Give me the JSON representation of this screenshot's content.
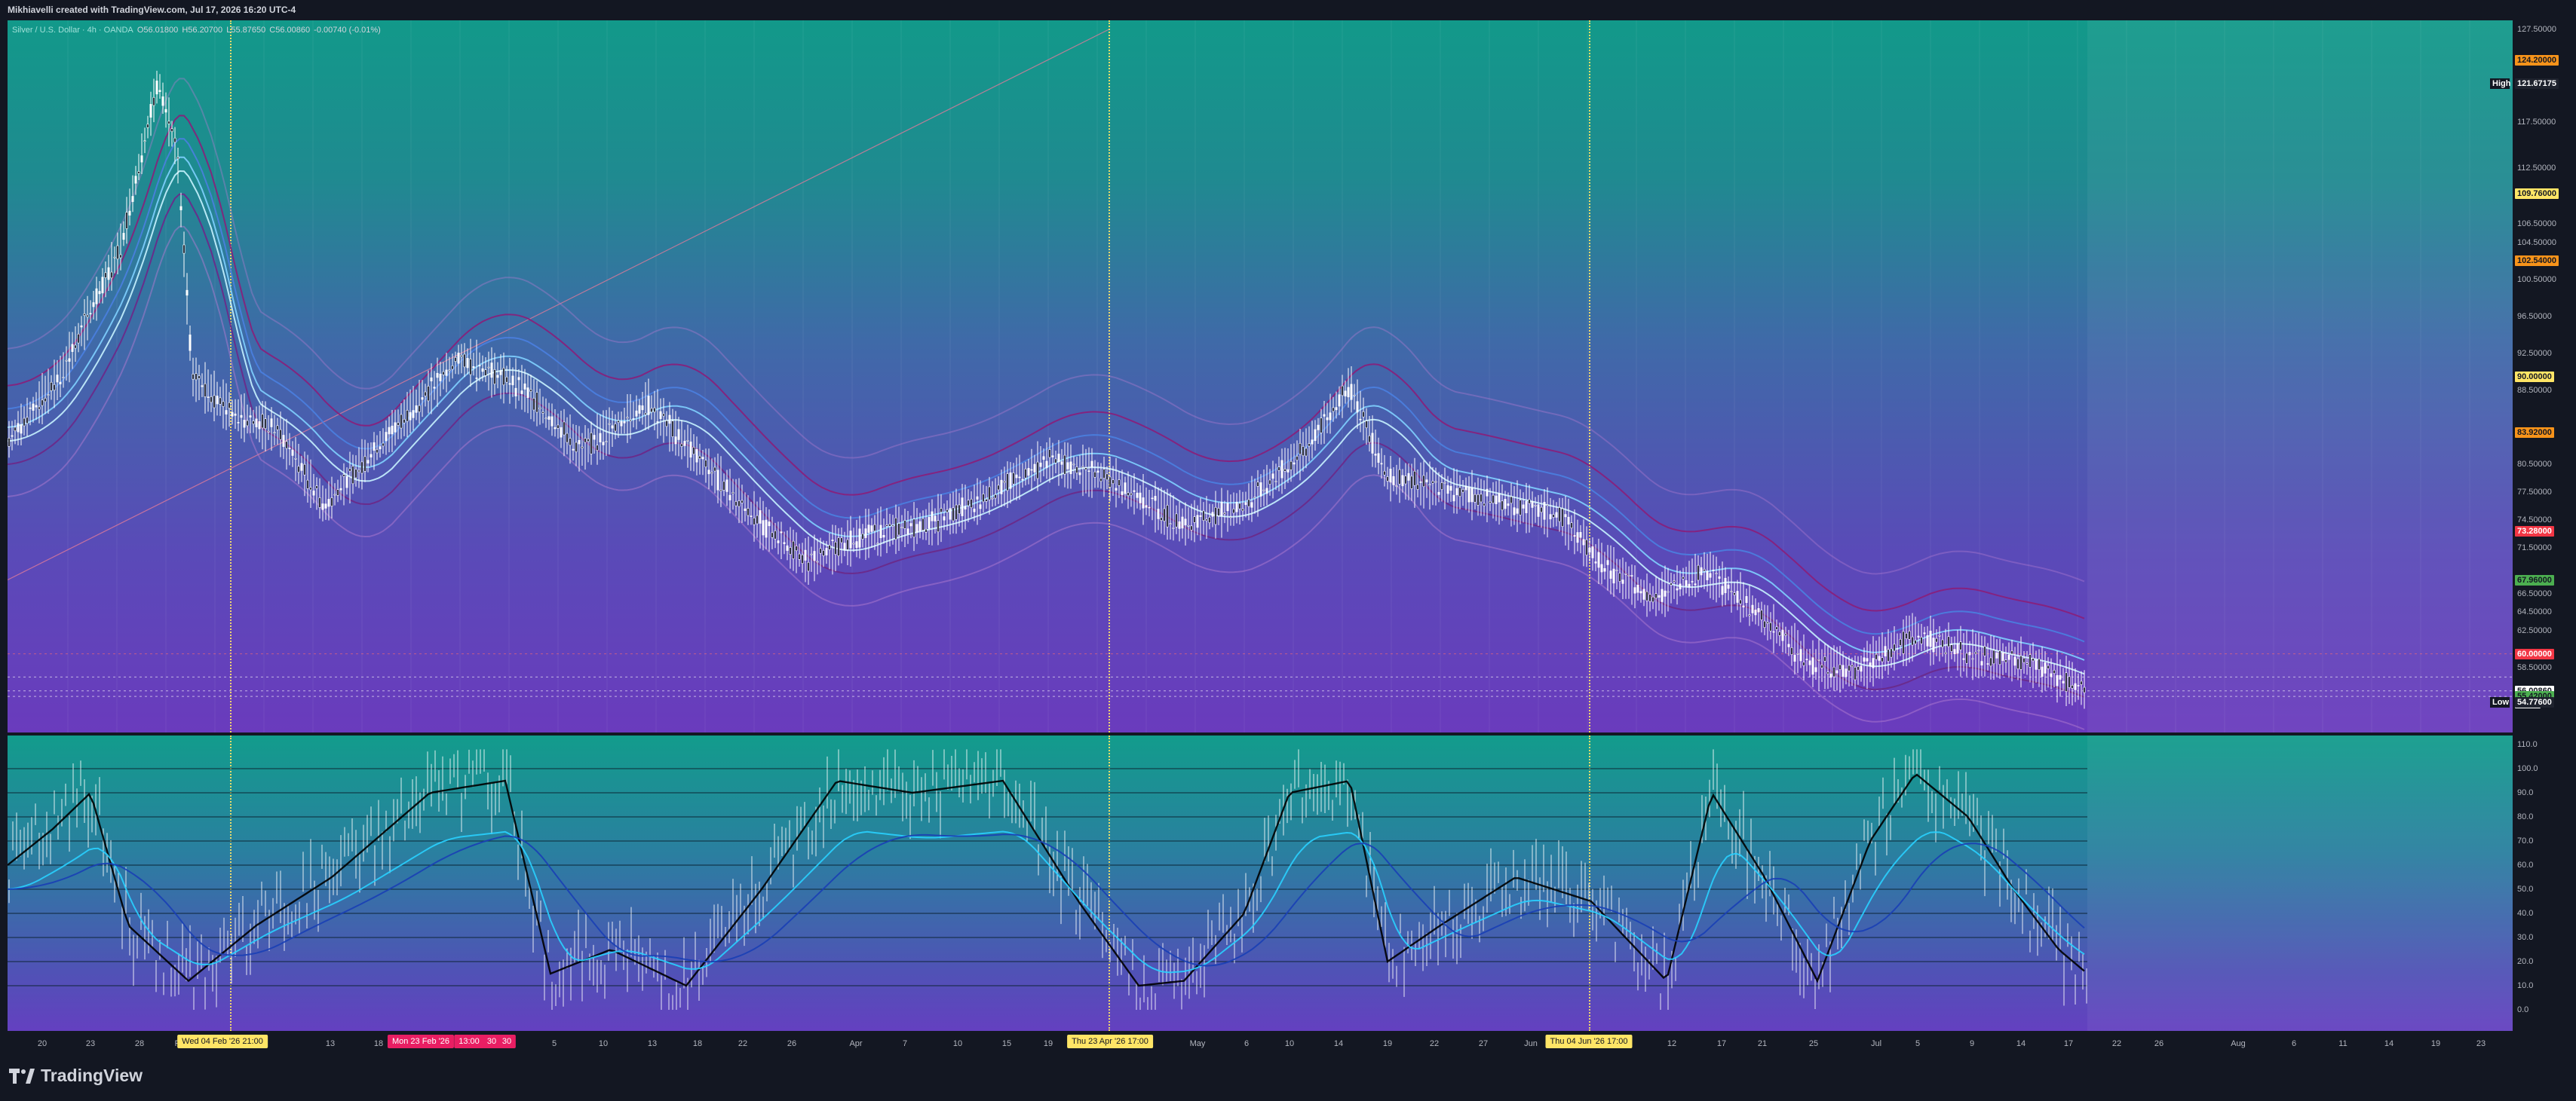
{
  "header": {
    "title": "Mikhiavelli created with TradingView.com, Jul 17, 2026 16:20 UTC-4"
  },
  "symbol": {
    "name": "Silver / U.S. Dollar · 4h · OANDA",
    "open": "O56.01800",
    "high": "H56.20700",
    "low": "L55.87650",
    "close": "C56.00860",
    "change": "-0.00740 (-0.01%)"
  },
  "colors": {
    "up": "#ffffff",
    "accent_yellow": "#ffe566",
    "accent_orange": "#f7931a",
    "accent_red": "#f23645",
    "accent_green": "#4caf50"
  },
  "price_axis": {
    "labels": [
      "127.50000",
      "117.50000",
      "112.50000",
      "106.50000",
      "104.50000",
      "100.50000",
      "96.50000",
      "92.50000",
      "88.50000",
      "80.50000",
      "77.50000",
      "74.50000",
      "71.50000",
      "66.50000",
      "64.50000",
      "62.50000",
      "58.50000"
    ],
    "badges": [
      {
        "text": "124.20000",
        "kind": "orange"
      },
      {
        "text": "121.67175",
        "kind": "dark"
      },
      {
        "text": "109.76000",
        "kind": "yellow"
      },
      {
        "text": "102.54000",
        "kind": "orange"
      },
      {
        "text": "90.00000",
        "kind": "yellow"
      },
      {
        "text": "83.92000",
        "kind": "orange"
      },
      {
        "text": "73.28000",
        "kind": "red"
      },
      {
        "text": "67.96000",
        "kind": "green"
      },
      {
        "text": "60.00000",
        "kind": "red"
      },
      {
        "text": "56.00860",
        "kind": "white"
      },
      {
        "text": "39:02",
        "kind": "white"
      },
      {
        "text": "55.42000",
        "kind": "green"
      },
      {
        "text": "54.77600",
        "kind": "dark"
      }
    ],
    "high_label": "High",
    "low_label": "Low"
  },
  "osc_axis": {
    "labels": [
      "110.0",
      "100.0",
      "90.0",
      "80.0",
      "70.0",
      "60.0",
      "50.0",
      "40.0",
      "30.0",
      "20.0",
      "10.0",
      "0.0"
    ]
  },
  "time_axis": {
    "labels": [
      "20",
      "23",
      "28",
      "F",
      "13",
      "18",
      "5",
      "10",
      "13",
      "18",
      "22",
      "26",
      "Apr",
      "7",
      "10",
      "15",
      "19",
      "May",
      "6",
      "10",
      "14",
      "19",
      "22",
      "27",
      "Jun",
      "12",
      "17",
      "21",
      "25",
      "Jul",
      "5",
      "9",
      "14",
      "17",
      "22",
      "26",
      "Aug",
      "6",
      "11",
      "14",
      "19",
      "23"
    ],
    "markers": [
      {
        "text": "Wed 04 Feb '26   21:00",
        "kind": "yellow"
      },
      {
        "text": "Mon 23 Feb '26",
        "kind": "pink"
      },
      {
        "text": "13:00",
        "kind": "pink"
      },
      {
        "text": "30",
        "kind": "pink"
      },
      {
        "text": "30",
        "kind": "pink"
      },
      {
        "text": "Thu 23 Apr '26   17:00",
        "kind": "yellow"
      },
      {
        "text": "Thu 04 Jun '26   17:00",
        "kind": "yellow"
      }
    ]
  },
  "brand": {
    "name": "TradingView"
  }
}
